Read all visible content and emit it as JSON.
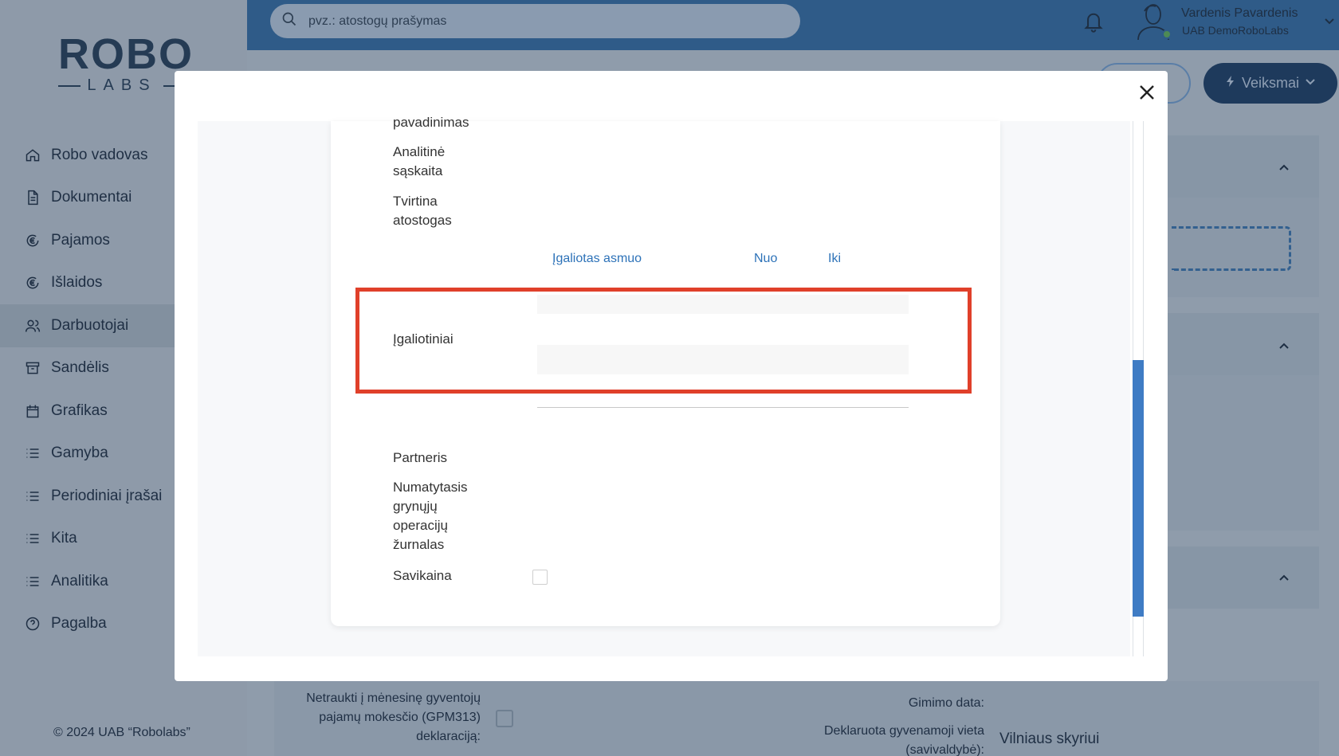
{
  "app": {
    "logo_text": "ROBO",
    "logo_sub": "LABS",
    "copyright": "© 2024 UAB “Robolabs”"
  },
  "sidebar": {
    "items": [
      {
        "label": "Robo vadovas",
        "icon": "home-icon"
      },
      {
        "label": "Dokumentai",
        "icon": "document-icon"
      },
      {
        "label": "Pajamos",
        "icon": "euro-in-icon"
      },
      {
        "label": "Išlaidos",
        "icon": "euro-out-icon"
      },
      {
        "label": "Darbuotojai",
        "icon": "users-icon",
        "active": true
      },
      {
        "label": "Sandėlis",
        "icon": "archive-icon"
      },
      {
        "label": "Grafikas",
        "icon": "calendar-icon"
      },
      {
        "label": "Gamyba",
        "icon": "list-icon"
      },
      {
        "label": "Periodiniai įrašai",
        "icon": "list-icon"
      },
      {
        "label": "Kita",
        "icon": "list-icon"
      },
      {
        "label": "Analitika",
        "icon": "list-icon"
      },
      {
        "label": "Pagalba",
        "icon": "help-icon"
      }
    ]
  },
  "header": {
    "search_placeholder": "pvz.: atostogų prašymas",
    "user_name": "Vardenis Pavardenis",
    "user_company": "UAB DemoRoboLabs",
    "actions_label": "Veiksmai"
  },
  "background_form": {
    "gpm_label_1": "Netraukti į mėnesinę gyventojų",
    "gpm_label_2": "pajamų mokesčio (GPM313)",
    "gpm_label_3": "deklaraciją:",
    "birth_date_label": "Gimimo data:",
    "residence_label_1": "Deklaruota gyvenamoji vieta",
    "residence_label_2": "(savivaldybė):",
    "residence_value": "Vilniaus skyriui"
  },
  "modal": {
    "fields": {
      "name_tail": "pavadinimas",
      "analytic_account_1": "Analitinė",
      "analytic_account_2": "sąskaita",
      "approves_leave_1": "Tvirtina",
      "approves_leave_2": "atostogas",
      "delegates": "Įgaliotiniai",
      "partner": "Partneris",
      "journal_1": "Numatytasis",
      "journal_2": "grynųjų",
      "journal_3": "operacijų",
      "journal_4": "žurnalas",
      "cost": "Savikaina"
    },
    "delegates_table": {
      "columns": [
        "Įgaliotas asmuo",
        "Nuo",
        "Iki"
      ]
    }
  },
  "colors": {
    "highlight": "#e0402a",
    "link_blue": "#2d72b8",
    "topbar": "#2f5b88",
    "scroll_thumb": "#3f7cc4"
  }
}
